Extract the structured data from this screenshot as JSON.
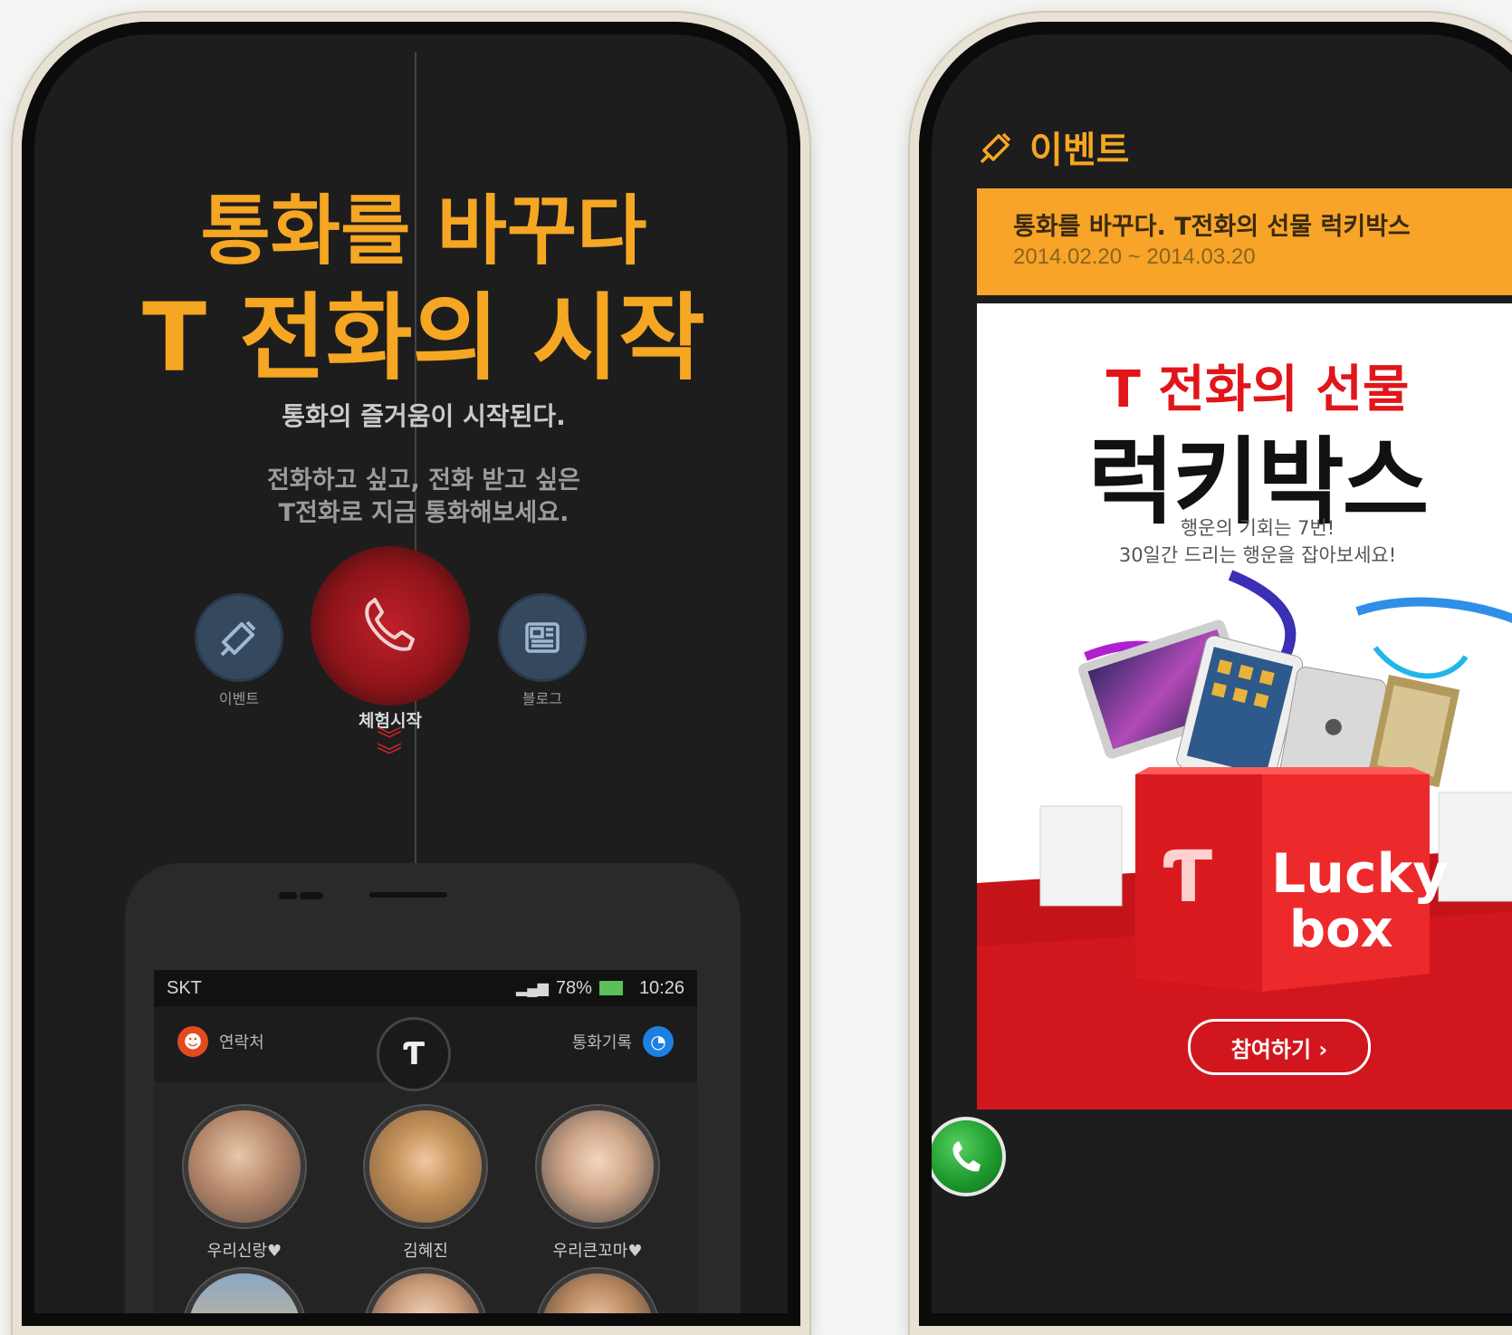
{
  "left_screen": {
    "headline_line1": "통화를 바꾸다",
    "headline_line2": "T 전화의 시작",
    "subtitle": "통화의 즐거움이 시작된다.",
    "description_line1": "전화하고 싶고, 전화 받고 싶은",
    "description_line2": "T전화로 지금 통화해보세요.",
    "buttons": [
      {
        "label": "이벤트",
        "icon": "megaphone-icon"
      },
      {
        "label": "체험시작",
        "icon": "phone-icon"
      },
      {
        "label": "블로그",
        "icon": "newspaper-icon"
      }
    ],
    "inner_phone": {
      "status_carrier": "SKT",
      "status_battery": "78%",
      "status_time": "10:26",
      "tab_contacts": "연락처",
      "tab_call_log": "통화기록",
      "contacts": [
        {
          "name": "우리신랑♥"
        },
        {
          "name": "김혜진"
        },
        {
          "name": "우리큰꼬마♥"
        }
      ]
    }
  },
  "right_screen": {
    "header_title": "이벤트",
    "banner_title": "통화를 바꾸다. T전화의 선물 럭키박스",
    "banner_date": "2014.02.20 ~ 2014.03.20",
    "promo_title_small": "T 전화의 선물",
    "promo_title_large": "럭키박스",
    "promo_line1": "행운의 기회는 7번!",
    "promo_line2": "30일간 드리는 행운을 잡아보세요!",
    "box_text_line1": "Lucky",
    "box_text_line2": "box",
    "join_button": "참여하기 ›"
  },
  "colors": {
    "accent_orange": "#f5a623",
    "red": "#e0161b",
    "dark_bg": "#1d1d1d",
    "call_green": "#1f9a2e"
  }
}
